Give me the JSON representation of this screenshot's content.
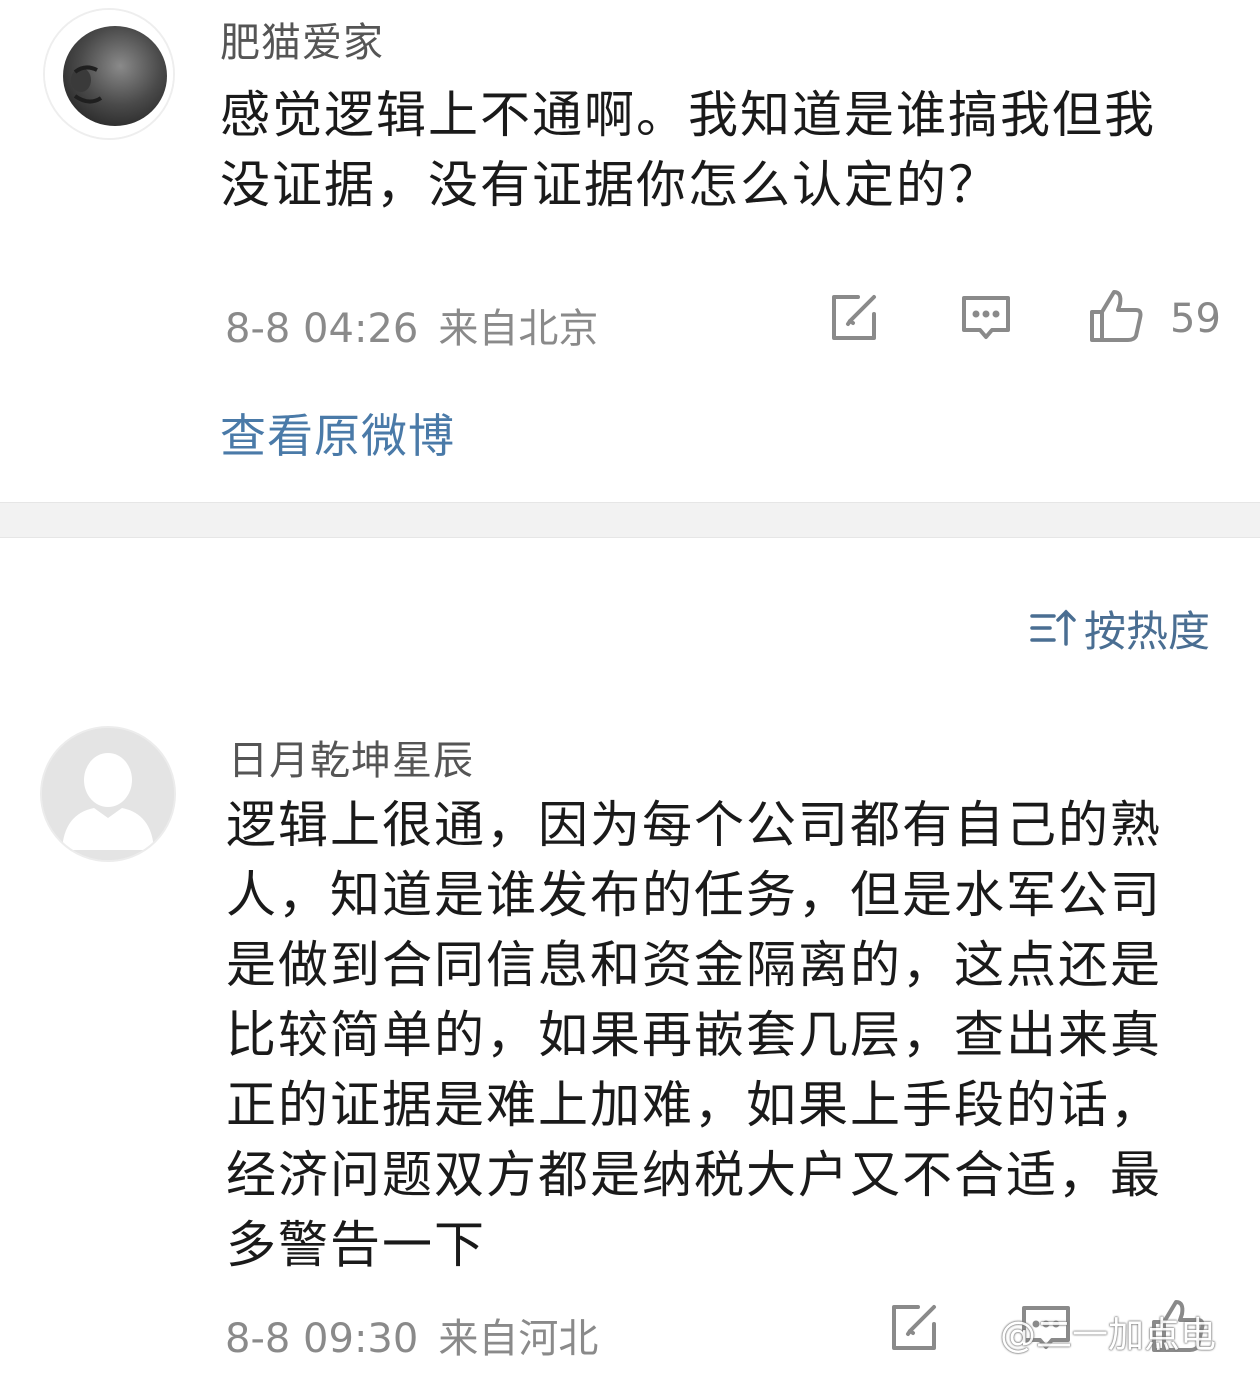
{
  "comment1": {
    "username": "肥猫爱家",
    "text": "感觉逻辑上不通啊。我知道是谁搞我但我没证据，没有证据你怎么认定的？",
    "time": "8-8 04:26",
    "location": "来自北京",
    "likes": "59",
    "avatar_icon": "fat-cat-avatar",
    "actions": [
      "share-icon",
      "comment-icon",
      "like-icon"
    ]
  },
  "view_original_label": "查看原微博",
  "sort": {
    "label": "按热度",
    "icon": "sort-icon"
  },
  "comment2": {
    "username": "日月乾坤星辰",
    "text": "逻辑上很通，因为每个公司都有自己的熟人，知道是谁发布的任务，但是水军公司是做到合同信息和资金隔离的，这点还是比较简单的，如果再嵌套几层，查出来真正的证据是难上加难，如果上手段的话，经济问题双方都是纳税大户又不合适，最多警告一下",
    "time": "8-8 09:30",
    "location": "来自河北",
    "avatar_icon": "default-user-avatar",
    "actions": [
      "share-icon",
      "comment-icon",
      "like-icon"
    ]
  },
  "watermark": "@二一加点电",
  "colors": {
    "link_blue": "#4a7aa8",
    "meta_gray": "#8a8a8a",
    "divider": "#f2f2f2"
  }
}
